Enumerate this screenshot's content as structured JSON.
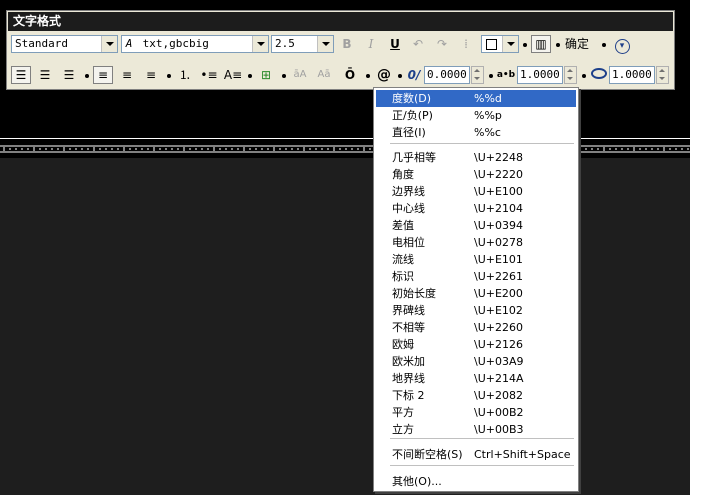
{
  "toolbar": {
    "title": "文字格式",
    "style_combo": "Standard",
    "font_icon": "A",
    "font_combo": "txt,gbcbig",
    "height_combo": "2.5",
    "bold_label": "B",
    "italic_label": "I",
    "underline_label": "U",
    "ok_label": "确定",
    "oblique_value": "0.0000",
    "tracking_value": "1.0000",
    "width_value": "1.0000",
    "row2": {
      "case_upper": "āA",
      "case_lower": "Aā",
      "overline": "Ō",
      "symbol": "@",
      "oblique_glyph": "0/",
      "tracking_glyph": "a•b"
    }
  },
  "symbol_menu": {
    "items": [
      {
        "label": "度数(D)",
        "code": "%%d",
        "highlighted": true
      },
      {
        "label": "正/负(P)",
        "code": "%%p"
      },
      {
        "label": "直径(I)",
        "code": "%%c"
      },
      {
        "label": "几乎相等",
        "code": "\\U+2248"
      },
      {
        "label": "角度",
        "code": "\\U+2220"
      },
      {
        "label": "边界线",
        "code": "\\U+E100"
      },
      {
        "label": "中心线",
        "code": "\\U+2104"
      },
      {
        "label": "差值",
        "code": "\\U+0394"
      },
      {
        "label": "电相位",
        "code": "\\U+0278"
      },
      {
        "label": "流线",
        "code": "\\U+E101"
      },
      {
        "label": "标识",
        "code": "\\U+2261"
      },
      {
        "label": "初始长度",
        "code": "\\U+E200"
      },
      {
        "label": "界碑线",
        "code": "\\U+E102"
      },
      {
        "label": "不相等",
        "code": "\\U+2260"
      },
      {
        "label": "欧姆",
        "code": "\\U+2126"
      },
      {
        "label": "欧米加",
        "code": "\\U+03A9"
      },
      {
        "label": "地界线",
        "code": "\\U+214A"
      },
      {
        "label": "下标 2",
        "code": "\\U+2082"
      },
      {
        "label": "平方",
        "code": "\\U+00B2"
      },
      {
        "label": "立方",
        "code": "\\U+00B3"
      },
      {
        "label": "不间断空格(S)",
        "code": "Ctrl+Shift+Space"
      },
      {
        "label": "其他(O)...",
        "code": ""
      }
    ]
  },
  "colors": {
    "highlight": "#3169c6",
    "toolbar_bg": "#ece9d8",
    "canvas_bg": "#1e1e1e"
  }
}
